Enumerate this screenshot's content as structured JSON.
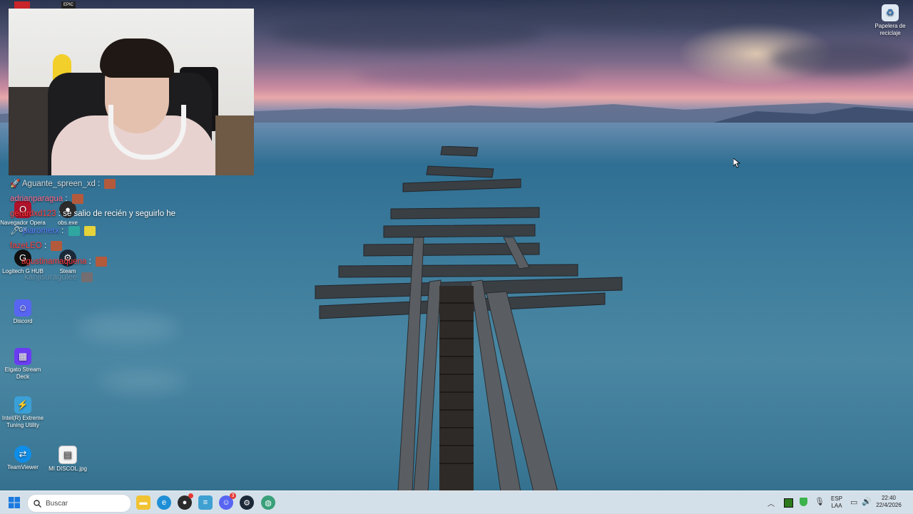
{
  "chat": [
    {
      "user": "Aguante_spreen_xd",
      "sep": ":",
      "message": "",
      "color": "#dcdcdc"
    },
    {
      "user": "adrianparagua",
      "sep": ":",
      "message": "",
      "color": "#ff6b8a"
    },
    {
      "user": "gerardxd123",
      "sep": ":",
      "message": "se salio de recién y seguirlo he",
      "color": "#ff3b3b"
    },
    {
      "user": "piaromerx",
      "sep": ":",
      "message": "",
      "color": "#5a7bff"
    },
    {
      "user": "fazeLEO",
      "sep": ":",
      "message": "",
      "color": "#ff3b3b"
    },
    {
      "user": "agustinamaquena",
      "sep": ":",
      "message": "",
      "color": "#ff3b3b"
    },
    {
      "user": "kanjisuragulee",
      "sep": ":",
      "message": "",
      "color": "#9aa5b5"
    }
  ],
  "desktop_icons": {
    "opera": "Navegador Opera GX",
    "obs": "obs.exe",
    "logitech": "Logitech G HUB",
    "steam": "Steam",
    "discord": "Discord",
    "elgato": "Elgato Stream Deck",
    "intel": "Intel(R) Extreme Tuning Utility",
    "teamviewer": "TeamViewer",
    "discol": "MI DISCOL.jpg",
    "recycle": "Papelera de reciclaje"
  },
  "top_left_labels": {
    "epic": "EPIC"
  },
  "taskbar": {
    "search_placeholder": "Buscar",
    "language_line1": "ESP",
    "language_line2": "LAA",
    "time": "22:40",
    "date": "22/4/2026",
    "discord_badge": "3",
    "overflow_icon": "chevron-up-icon"
  },
  "colors": {
    "taskbar_bg": "#e1e8f0",
    "windows_blue": "#1a7ae0",
    "discord": "#5865f2",
    "steam": "#1b2838"
  }
}
